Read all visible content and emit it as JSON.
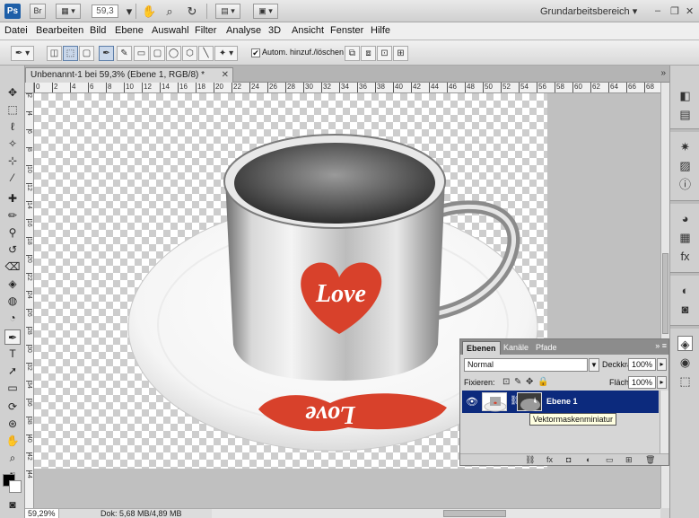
{
  "app": {
    "logo": "Ps",
    "bridge_label": "Br",
    "zoom_value": "59,3",
    "workspace": "Grundarbeitsbereich"
  },
  "menu": [
    "Datei",
    "Bearbeiten",
    "Bild",
    "Ebene",
    "Auswahl",
    "Filter",
    "Analyse",
    "3D",
    "Ansicht",
    "Fenster",
    "Hilfe"
  ],
  "options": {
    "auto_add_delete_label": "Autom. hinzuf./löschen",
    "auto_add_delete_checked": true
  },
  "document": {
    "tab_title": "Unbenannt-1 bei 59,3% (Ebene 1, RGB/8) *",
    "ruler_marks": [
      "0",
      "2",
      "4",
      "6",
      "8",
      "10",
      "12",
      "14",
      "16",
      "18",
      "20",
      "22",
      "24",
      "26",
      "28",
      "30",
      "32",
      "34",
      "36",
      "38",
      "40",
      "42",
      "44",
      "46",
      "48",
      "50",
      "52",
      "54",
      "56",
      "58",
      "60",
      "62",
      "64",
      "66",
      "68"
    ],
    "ruler_left_marks": [
      "2",
      "4",
      "6",
      "8",
      "10",
      "12",
      "14",
      "16",
      "18",
      "20",
      "22",
      "24",
      "26",
      "28",
      "30",
      "32",
      "34",
      "36",
      "38",
      "40",
      "42",
      "44"
    ],
    "mug_text": "Love",
    "reflection_text": "Love"
  },
  "status": {
    "zoom": "59,29%",
    "doc_info": "Dok: 5,68 MB/4,89 MB"
  },
  "layers_panel": {
    "tabs": [
      "Ebenen",
      "Kanäle",
      "Pfade"
    ],
    "blend_mode": "Normal",
    "opacity_label": "Deckkraft:",
    "opacity_value": "100%",
    "lock_label": "Fixieren:",
    "fill_label": "Fläche:",
    "fill_value": "100%",
    "layer_name": "Ebene 1",
    "tooltip": "Vektormaskenminiatur"
  },
  "colors": {
    "selected_layer": "#0c2a7d",
    "heart_red": "#d8412b",
    "checker": "#cdcdcd"
  }
}
